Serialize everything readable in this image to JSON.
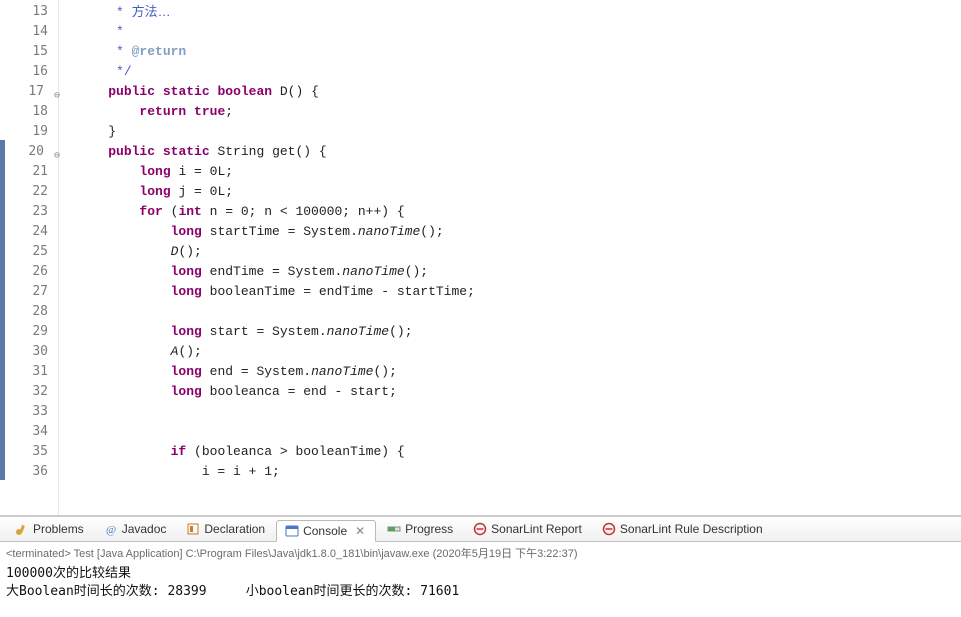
{
  "editor": {
    "lines": [
      {
        "num": "13",
        "fold": "",
        "cls": "",
        "html": "     <span class='comment'>* <span class='zh'>方法…</span></span>"
      },
      {
        "num": "14",
        "fold": "",
        "cls": "",
        "html": "     <span class='comment'>*</span>"
      },
      {
        "num": "15",
        "fold": "",
        "cls": "",
        "html": "     <span class='comment'>* <span class='tag'>@return</span></span>"
      },
      {
        "num": "16",
        "fold": "",
        "cls": "",
        "html": "     <span class='comment'>*/</span>"
      },
      {
        "num": "17",
        "fold": "⊖",
        "cls": "",
        "html": "    <span class='kw'>public</span> <span class='kw'>static</span> <span class='kw'>boolean</span> D() {"
      },
      {
        "num": "18",
        "fold": "",
        "cls": "",
        "html": "        <span class='kw'>return</span> <span class='kw'>true</span>;"
      },
      {
        "num": "19",
        "fold": "",
        "cls": "",
        "html": "    }"
      },
      {
        "num": "20",
        "fold": "⊖",
        "cls": "blue",
        "html": "    <span class='kw'>public</span> <span class='kw'>static</span> String get() {"
      },
      {
        "num": "21",
        "fold": "",
        "cls": "blue",
        "html": "        <span class='kw'>long</span> i = 0L;"
      },
      {
        "num": "22",
        "fold": "",
        "cls": "blue",
        "html": "        <span class='kw'>long</span> j = 0L;"
      },
      {
        "num": "23",
        "fold": "",
        "cls": "blue",
        "html": "        <span class='kw'>for</span> (<span class='kw'>int</span> n = 0; n &lt; 100000; n++) {"
      },
      {
        "num": "24",
        "fold": "",
        "cls": "blue",
        "html": "            <span class='kw'>long</span> startTime = System.<span class='method-italic'>nanoTime</span>();"
      },
      {
        "num": "25",
        "fold": "",
        "cls": "blue",
        "html": "            <span class='method-italic'>D</span>();"
      },
      {
        "num": "26",
        "fold": "",
        "cls": "blue",
        "html": "            <span class='kw'>long</span> endTime = System.<span class='method-italic'>nanoTime</span>();"
      },
      {
        "num": "27",
        "fold": "",
        "cls": "blue",
        "html": "            <span class='kw'>long</span> booleanTime = endTime - startTime;"
      },
      {
        "num": "28",
        "fold": "",
        "cls": "blue",
        "html": ""
      },
      {
        "num": "29",
        "fold": "",
        "cls": "blue",
        "html": "            <span class='kw'>long</span> start = System.<span class='method-italic'>nanoTime</span>();"
      },
      {
        "num": "30",
        "fold": "",
        "cls": "blue",
        "html": "            <span class='method-italic'>A</span>();"
      },
      {
        "num": "31",
        "fold": "",
        "cls": "blue",
        "html": "            <span class='kw'>long</span> end = System.<span class='method-italic'>nanoTime</span>();"
      },
      {
        "num": "32",
        "fold": "",
        "cls": "blue",
        "html": "            <span class='kw'>long</span> booleanca = end - start;"
      },
      {
        "num": "33",
        "fold": "",
        "cls": "blue",
        "html": ""
      },
      {
        "num": "34",
        "fold": "",
        "cls": "blue",
        "html": ""
      },
      {
        "num": "35",
        "fold": "",
        "cls": "blue",
        "html": "            <span class='kw'>if</span> (booleanca &gt; booleanTime) {"
      },
      {
        "num": "36",
        "fold": "",
        "cls": "blue",
        "html": "                i = i + 1;"
      }
    ]
  },
  "tabs": {
    "problems": "Problems",
    "javadoc": "Javadoc",
    "declaration": "Declaration",
    "console": "Console",
    "progress": "Progress",
    "sonarlint_report": "SonarLint Report",
    "sonarlint_rule": "SonarLint Rule Description"
  },
  "console": {
    "header": "<terminated> Test [Java Application] C:\\Program Files\\Java\\jdk1.8.0_181\\bin\\javaw.exe (2020年5月19日 下午3:22:37)",
    "line1": "100000次的比较结果",
    "line2": "大Boolean时间长的次数: 28399     小boolean时间更长的次数: 71601"
  },
  "icons": {
    "problems_color": "#d9a33b",
    "javadoc_color": "#4a76c7",
    "declaration_color": "#c77b2c",
    "console_color": "#4a76c7",
    "progress_color": "#5aa35a",
    "sonar_stop": "#c9302c"
  }
}
